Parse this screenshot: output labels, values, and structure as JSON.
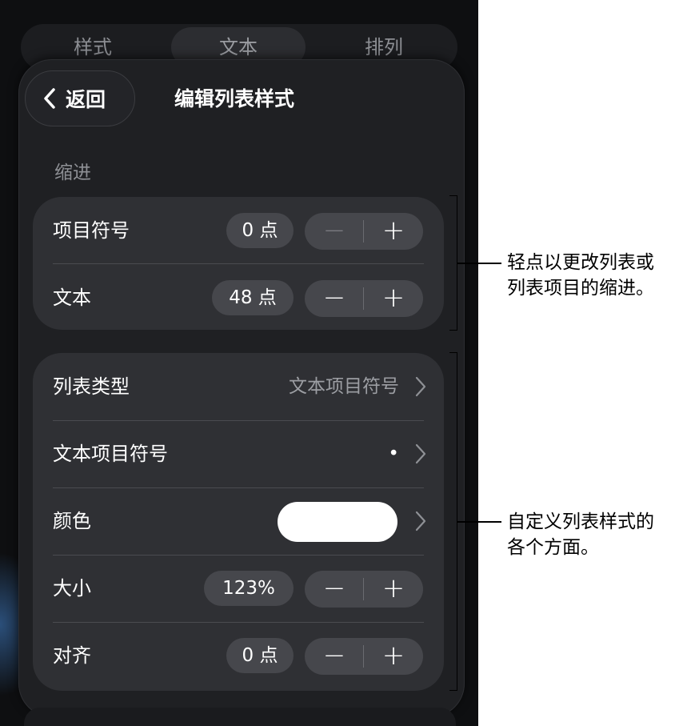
{
  "tabs": [
    {
      "label": "样式"
    },
    {
      "label": "文本"
    },
    {
      "label": "排列"
    }
  ],
  "nav": {
    "back_label": "返回",
    "title": "编辑列表样式"
  },
  "indent_section": {
    "label": "缩进",
    "rows": [
      {
        "label": "项目符号",
        "value": "0 点",
        "minus": "−",
        "plus": "+"
      },
      {
        "label": "文本",
        "value": "48 点",
        "minus": "−",
        "plus": "+"
      }
    ]
  },
  "style_section": {
    "list_type": {
      "label": "列表类型",
      "value": "文本项目符号"
    },
    "text_bullet": {
      "label": "文本项目符号",
      "value": "•"
    },
    "color": {
      "label": "颜色",
      "swatch": "#ffffff"
    },
    "size": {
      "label": "大小",
      "value": "123%",
      "minus": "−",
      "plus": "+"
    },
    "align": {
      "label": "对齐",
      "value": "0 点",
      "minus": "−",
      "plus": "+"
    }
  },
  "callouts": {
    "indent_line1": "轻点以更改列表或",
    "indent_line2": "列表项目的缩进。",
    "style_line1": "自定义列表样式的",
    "style_line2": "各个方面。"
  }
}
